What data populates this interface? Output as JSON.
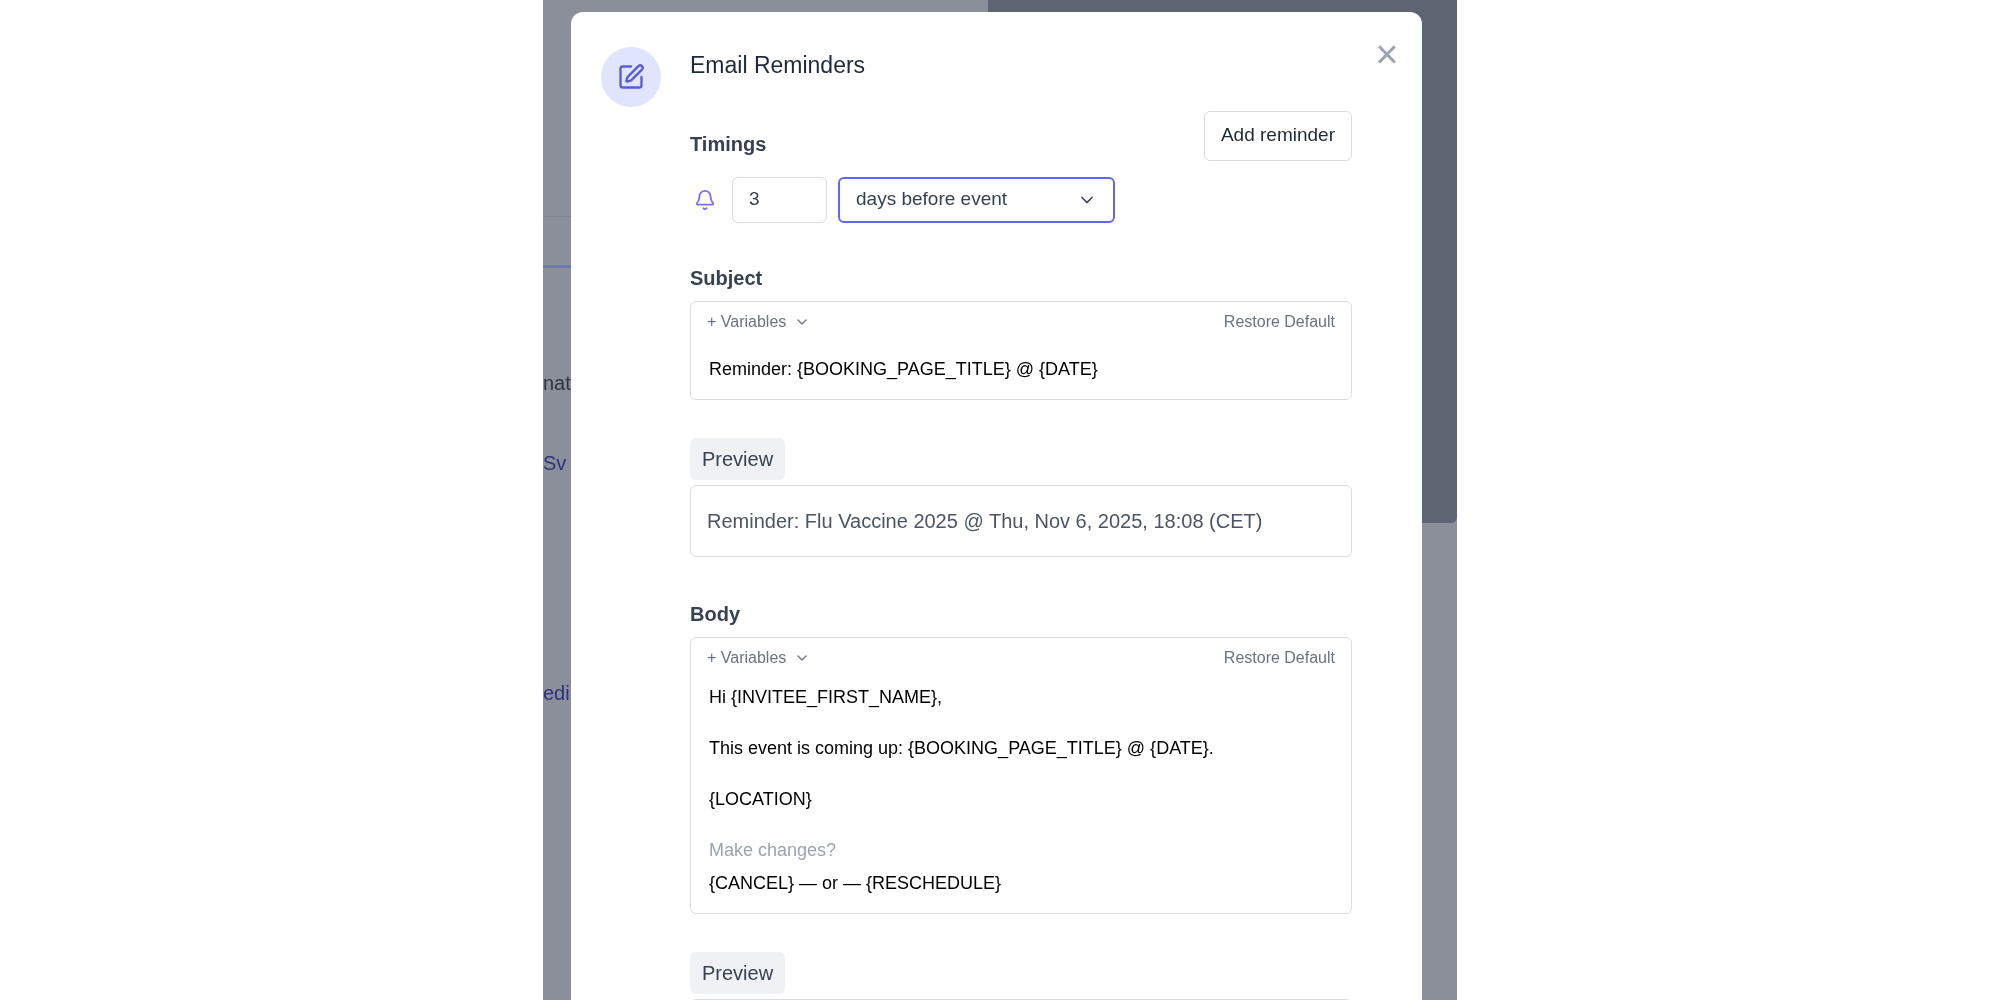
{
  "background": {
    "fragments": [
      "nat",
      "Sv",
      "edi"
    ]
  },
  "dialog": {
    "title": "Email Reminders",
    "close": "×",
    "timings": {
      "label": "Timings",
      "add_button": "Add reminder",
      "amount": "3",
      "unit": {
        "value": "days before event",
        "focused": true
      }
    },
    "subject": {
      "label": "Subject",
      "variables": "+ Variables",
      "restore": "Restore Default",
      "value": "Reminder: {BOOKING_PAGE_TITLE} @ {DATE}"
    },
    "subject_preview": {
      "label": "Preview",
      "text": "Reminder: Flu Vaccine 2025 @ Thu, Nov 6, 2025, 18:08 (CET)"
    },
    "body": {
      "label": "Body",
      "variables": "+ Variables",
      "restore": "Restore Default",
      "paragraphs": [
        [
          {
            "text": "Hi {INVITEE_FIRST_NAME},",
            "muted": false
          }
        ],
        [
          {
            "text": "This event is coming up: {BOOKING_PAGE_TITLE} @ {DATE}.",
            "muted": false
          }
        ],
        [
          {
            "text": "{LOCATION}",
            "muted": false
          }
        ],
        [
          {
            "text": "Make changes?",
            "muted": true
          },
          {
            "text": "{CANCEL} — or — {RESCHEDULE}",
            "muted": false
          }
        ]
      ]
    },
    "body_preview": {
      "label": "Preview"
    }
  }
}
